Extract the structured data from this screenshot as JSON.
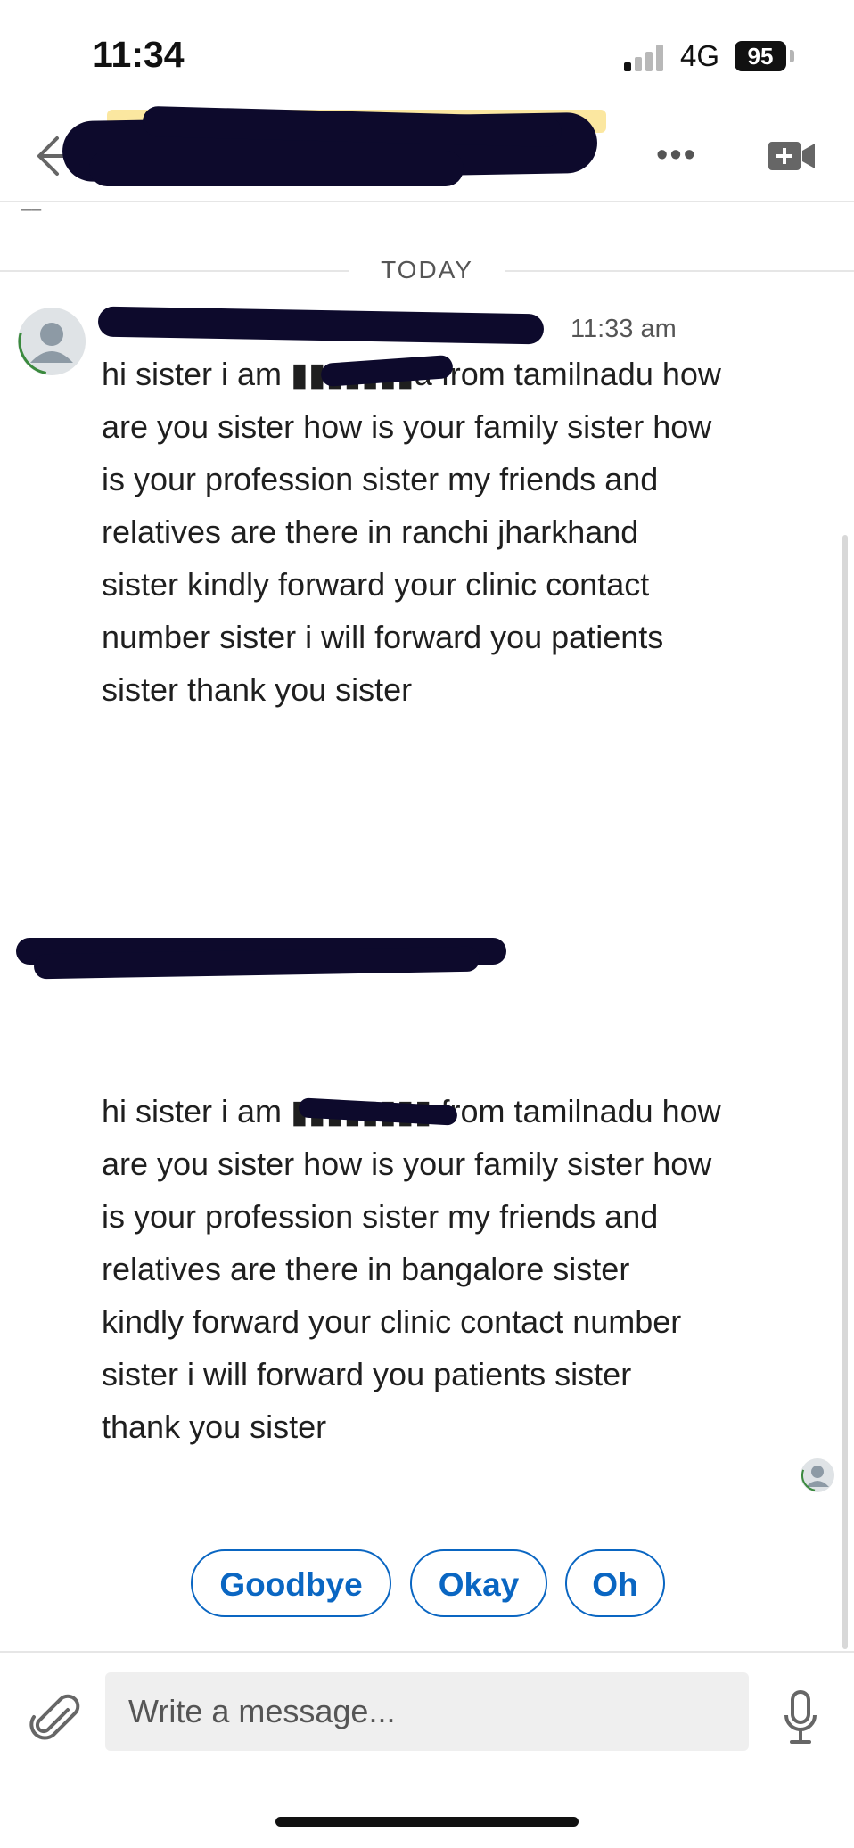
{
  "status_bar": {
    "time": "11:34",
    "network": "4G",
    "battery": "95"
  },
  "header": {
    "back_icon": "arrow-left-icon",
    "more_label": "•••",
    "video_icon": "video-call-icon",
    "contact_name_redacted": true
  },
  "conversation": {
    "date_divider": "TODAY",
    "messages": [
      {
        "time": "11:33 am",
        "text": "hi sister i am ▮▮▮▮▮▮▮a from tamilnadu how\nare you sister how is your family sister how\nis your profession sister my friends and\nrelatives are there in ranchi jharkhand\nsister kindly forward your clinic contact\nnumber sister i will forward you patients\nsister thank you sister"
      },
      {
        "text": "hi sister i am ▮▮▮▮▮▮▮▮ from tamilnadu how\nare you sister how is your family sister how\nis your profession sister my friends and\nrelatives are there in bangalore sister\nkindly forward your clinic contact number\nsister i will forward you patients sister\nthank you sister"
      }
    ]
  },
  "quick_replies": [
    "Goodbye",
    "Okay",
    "Oh"
  ],
  "composer": {
    "placeholder": "Write a message...",
    "attach_icon": "paperclip-icon",
    "mic_icon": "microphone-icon"
  },
  "colors": {
    "accent": "#0a66c2",
    "redaction": "#0d0a2c",
    "input_bg": "#efefef"
  }
}
